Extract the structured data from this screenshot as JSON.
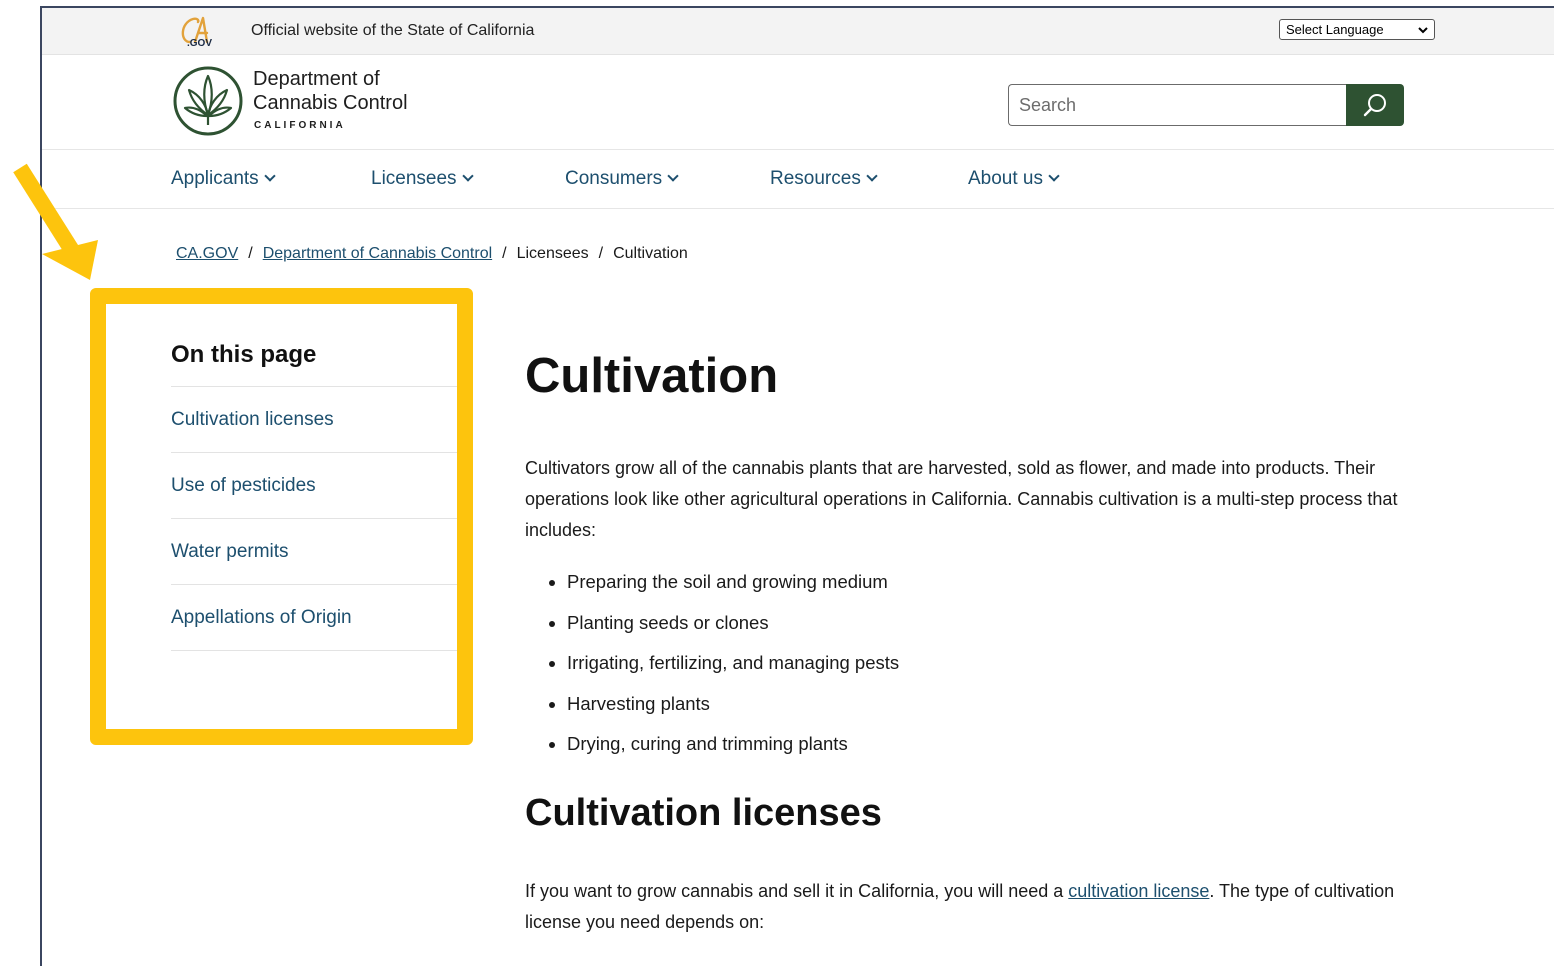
{
  "colors": {
    "accent_yellow": "#fdc40d",
    "link_blue": "#1d4f6e",
    "search_button_green": "#2e5232",
    "utility_bar": "#f3f3f3"
  },
  "utility_bar": {
    "logo_text": ".GOV",
    "official_text": "Official website of the State of California",
    "language_select": "Select Language"
  },
  "header": {
    "brand_line1": "Department of",
    "brand_line2": "Cannabis Control",
    "brand_line3": "CALIFORNIA",
    "search_placeholder": "Search",
    "search_icon": "search-icon"
  },
  "nav": {
    "items": [
      {
        "label": "Applicants"
      },
      {
        "label": "Licensees"
      },
      {
        "label": "Consumers"
      },
      {
        "label": "Resources"
      },
      {
        "label": "About us"
      }
    ]
  },
  "breadcrumb": {
    "items": [
      "CA.GOV",
      "Department of Cannabis Control",
      "Licensees",
      "Cultivation"
    ],
    "separator": "/"
  },
  "toc": {
    "heading": "On this page",
    "items": [
      "Cultivation licenses",
      "Use of pesticides",
      "Water permits",
      "Appellations of Origin"
    ]
  },
  "main": {
    "title": "Cultivation",
    "intro": "Cultivators grow all of the cannabis plants that are harvested, sold as flower, and made into products. Their operations look like other agricultural operations in California. Cannabis cultivation is a multi-step process that includes:",
    "bullets": [
      "Preparing the soil and growing medium",
      "Planting seeds or clones",
      "Irrigating, fertilizing, and managing pests",
      "Harvesting plants",
      "Drying, curing and trimming plants"
    ],
    "section_title": "Cultivation licenses",
    "para_before": "If you want to grow cannabis and sell it in California, you will need a ",
    "para_link": "cultivation license",
    "para_after": ". The type of cultivation license you need depends on:"
  }
}
